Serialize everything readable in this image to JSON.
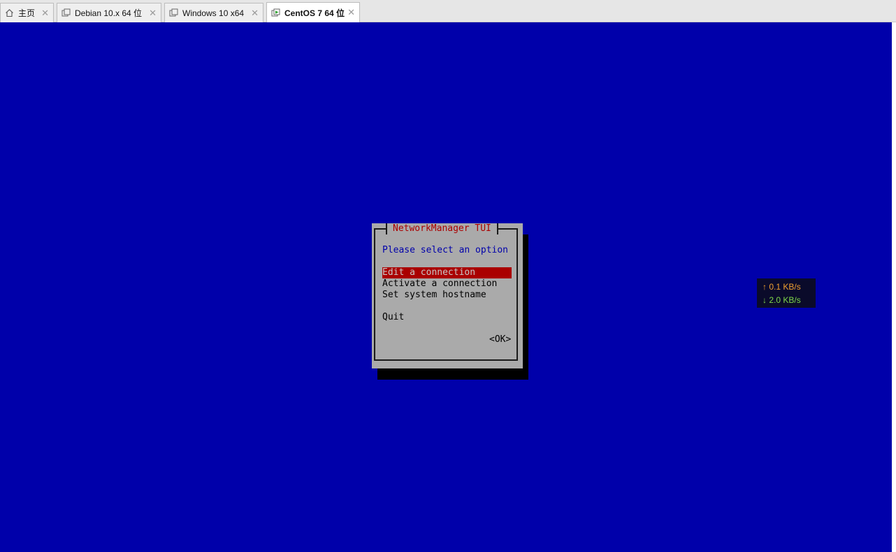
{
  "tabs": [
    {
      "label": "主页",
      "icon": "home-icon",
      "active": false
    },
    {
      "label": "Debian 10.x 64 位",
      "icon": "vm-icon",
      "active": false
    },
    {
      "label": "Windows 10 x64",
      "icon": "vm-icon",
      "active": false
    },
    {
      "label": "CentOS 7 64 位",
      "icon": "vm-running-icon",
      "active": true
    }
  ],
  "close_glyph": "✕",
  "dialog": {
    "title": "NetworkManager TUI",
    "prompt": "Please select an option",
    "items": [
      {
        "label": "Edit a connection",
        "selected": true
      },
      {
        "label": "Activate a connection",
        "selected": false
      },
      {
        "label": "Set system hostname",
        "selected": false
      },
      {
        "label": "Quit",
        "selected": false
      }
    ],
    "ok_label": "<OK>"
  },
  "netspeed": {
    "upload": "↑ 0.1 KB/s",
    "download": "↓ 2.0 KB/s"
  },
  "colors": {
    "console_bg": "#0000aa",
    "dialog_bg": "#aaaaaa",
    "title_fg": "#aa0000",
    "prompt_fg": "#0000aa",
    "selected_bg": "#aa0000",
    "upload_fg": "#f0a030",
    "download_fg": "#7fd84a"
  }
}
